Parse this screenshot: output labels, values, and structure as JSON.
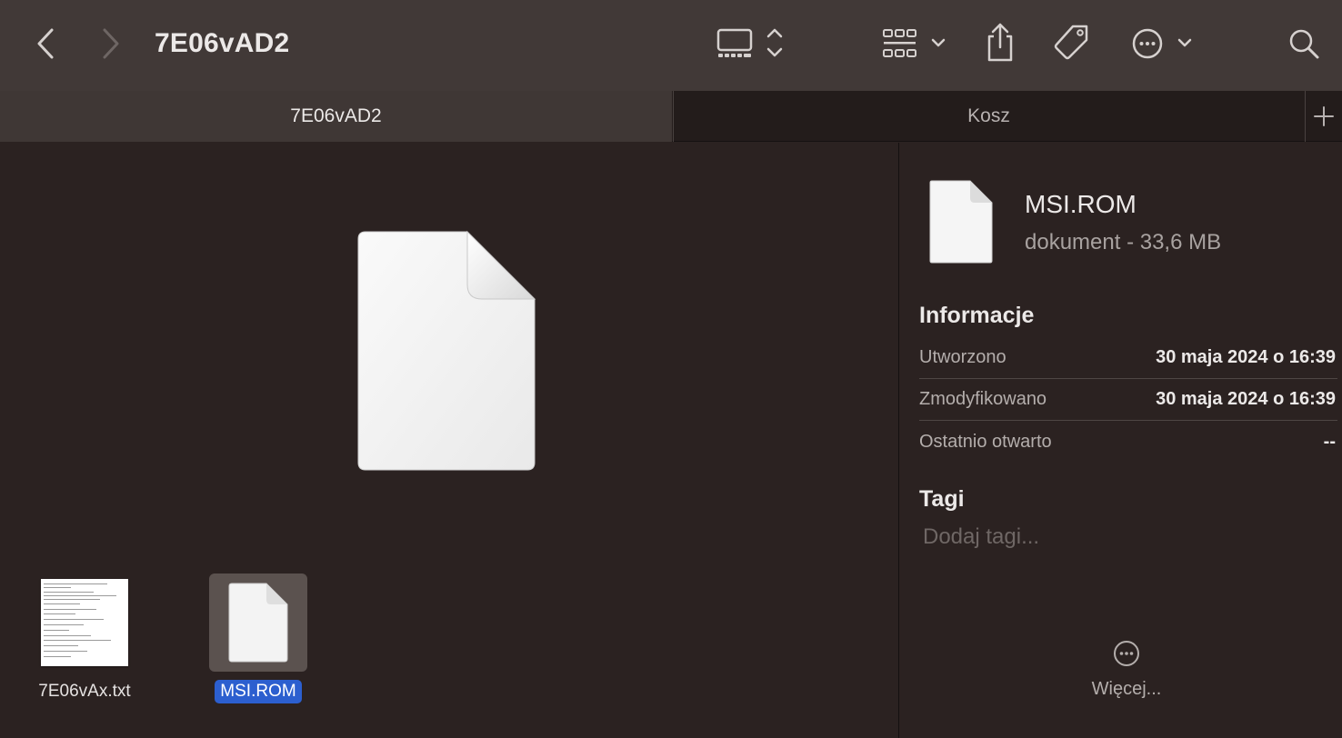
{
  "window": {
    "title": "7E06vAD2"
  },
  "toolbar": {
    "icons": [
      "chevron-left-icon",
      "chevron-right-icon",
      "gallery-view-icon",
      "group-grid-icon",
      "share-icon",
      "tag-icon",
      "ellipsis-circle-icon",
      "search-icon"
    ]
  },
  "tabs": [
    {
      "label": "7E06vAD2",
      "active": true
    },
    {
      "label": "Kosz",
      "active": false
    }
  ],
  "files": [
    {
      "name": "7E06vAx.txt",
      "selected": false
    },
    {
      "name": "MSI.ROM",
      "selected": true
    }
  ],
  "inspector": {
    "name": "MSI.ROM",
    "kind": "dokument - 33,6 MB",
    "info_title": "Informacje",
    "rows": [
      {
        "key": "Utworzono",
        "value": "30 maja 2024 o 16:39"
      },
      {
        "key": "Zmodyfikowano",
        "value": "30 maja 2024 o 16:39"
      },
      {
        "key": "Ostatnio otwarto",
        "value": "--"
      }
    ],
    "tags_title": "Tagi",
    "tags_placeholder": "Dodaj tagi...",
    "more_label": "Więcej..."
  },
  "colors": {
    "toolbar_bg": "#413937",
    "content_bg": "#2b2221",
    "selection": "#2c5fcf"
  }
}
